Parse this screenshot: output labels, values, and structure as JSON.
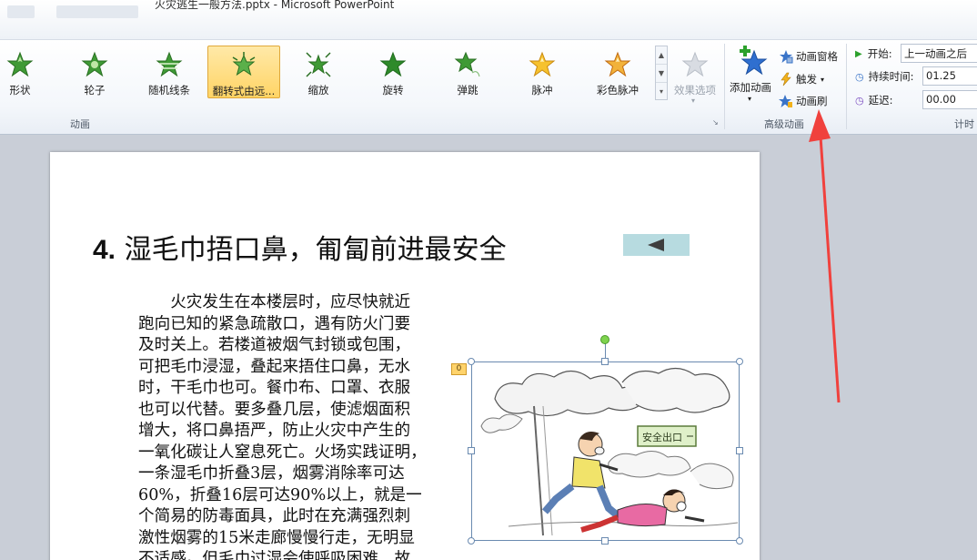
{
  "window": {
    "title": "火灾逃生一般方法.pptx - Microsoft PowerPoint"
  },
  "ribbon": {
    "animation_group": {
      "label": "动画",
      "effects": [
        {
          "label": "形状",
          "icon": "star-green-shape-icon"
        },
        {
          "label": "轮子",
          "icon": "star-green-wheel-icon"
        },
        {
          "label": "随机线条",
          "icon": "star-green-lines-icon"
        },
        {
          "label": "翻转式由远...",
          "icon": "star-green-flip-icon",
          "selected": true
        },
        {
          "label": "缩放",
          "icon": "star-green-zoom-icon"
        },
        {
          "label": "旋转",
          "icon": "star-green-spin-icon"
        },
        {
          "label": "弹跳",
          "icon": "star-green-bounce-icon"
        },
        {
          "label": "脉冲",
          "icon": "star-gold-pulse-icon"
        },
        {
          "label": "彩色脉冲",
          "icon": "star-gold-color-pulse-icon"
        }
      ],
      "effect_options": "效果选项"
    },
    "advanced_group": {
      "label": "高级动画",
      "add_animation": "添加动画",
      "animation_pane": "动画窗格",
      "trigger": "触发",
      "animation_painter": "动画刷"
    },
    "timing_group": {
      "label": "计时",
      "start_label": "开始:",
      "start_value": "上一动画之后",
      "duration_label": "持续时间:",
      "duration_value": "01.25",
      "delay_label": "延迟:",
      "delay_value": "00.00"
    }
  },
  "slide": {
    "title_number": "4.",
    "title_text": "湿毛巾捂口鼻，匍匐前进最安全",
    "animation_tag": "0",
    "body_lines": [
      "火灾发生在本楼层时，应尽快就近",
      "跑向已知的紧急疏散口，遇有防火门要",
      "及时关上。若楼道被烟气封锁或包围，",
      "可把毛巾浸湿，叠起来捂住口鼻，无水",
      "时，干毛巾也可。餐巾布、口罩、衣服",
      "也可以代替。要多叠几层，使滤烟面积",
      "增大，将口鼻捂严，防止火灾中产生的",
      "一氧化碳让人窒息死亡。火场实践证明，",
      "一条湿毛巾折叠3层，烟雾消除率可达",
      "60%，折叠16层可达90%以上，就是一",
      "个简易的防毒面具，此时在充满强烈刺",
      "激性烟雾的15米走廊慢慢行走，无明显",
      "不适感。但毛巾过湿会使呼吸困难，故"
    ],
    "picture_sign": "安全出口"
  },
  "colors": {
    "accent_arrow": "#f0413d",
    "selected_effect": "#ffd465",
    "back_button": "#b7dbe0"
  }
}
